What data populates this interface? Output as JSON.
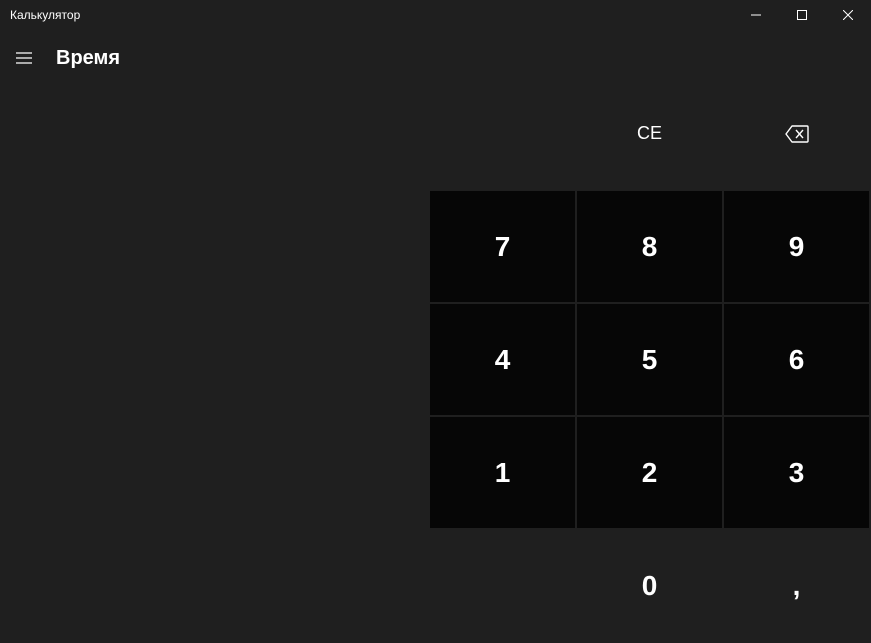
{
  "window": {
    "title": "Калькулятор"
  },
  "header": {
    "mode": "Время"
  },
  "keypad": {
    "ce": "CE",
    "n7": "7",
    "n8": "8",
    "n9": "9",
    "n4": "4",
    "n5": "5",
    "n6": "6",
    "n1": "1",
    "n2": "2",
    "n3": "3",
    "n0": "0",
    "decimal": ","
  }
}
